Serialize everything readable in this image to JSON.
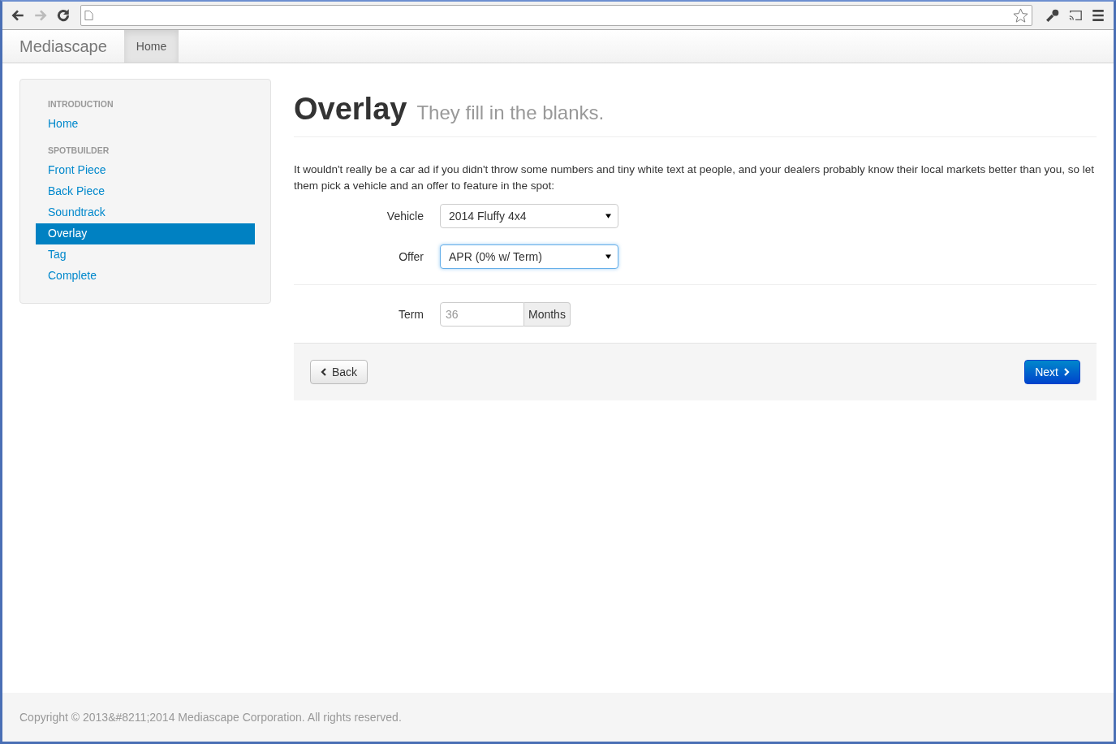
{
  "navbar": {
    "brand": "Mediascape",
    "items": [
      {
        "label": "Home",
        "selected": true
      }
    ]
  },
  "sidebar": {
    "sections": [
      {
        "header": "INTRODUCTION",
        "items": [
          {
            "label": "Home",
            "selected": false
          }
        ]
      },
      {
        "header": "SPOTBUILDER",
        "items": [
          {
            "label": "Front Piece",
            "selected": false
          },
          {
            "label": "Back Piece",
            "selected": false
          },
          {
            "label": "Soundtrack",
            "selected": false
          },
          {
            "label": "Overlay",
            "selected": true
          },
          {
            "label": "Tag",
            "selected": false
          },
          {
            "label": "Complete",
            "selected": false
          }
        ]
      }
    ]
  },
  "page": {
    "title": "Overlay",
    "subtitle": "They fill in the blanks.",
    "intro": "It wouldn't really be a car ad if you didn't throw some numbers and tiny white text at people, and your dealers probably know their local markets better than you, so let them pick a vehicle and an offer to feature in the spot:"
  },
  "fields": [
    {
      "kind": "select",
      "label": "Vehicle",
      "value": "2014 Fluffy 4x4",
      "focused": false
    },
    {
      "kind": "select",
      "label": "Offer",
      "value": "APR (0% w/ Term)",
      "focused": true
    },
    {
      "kind": "divider"
    },
    {
      "kind": "appended",
      "label": "Term",
      "placeholder": "36",
      "addon": "Months"
    }
  ],
  "actions": {
    "back": "Back",
    "next": "Next"
  },
  "footer": "Copyright © 2013&#8211;2014 Mediascape Corporation. All rights reserved."
}
